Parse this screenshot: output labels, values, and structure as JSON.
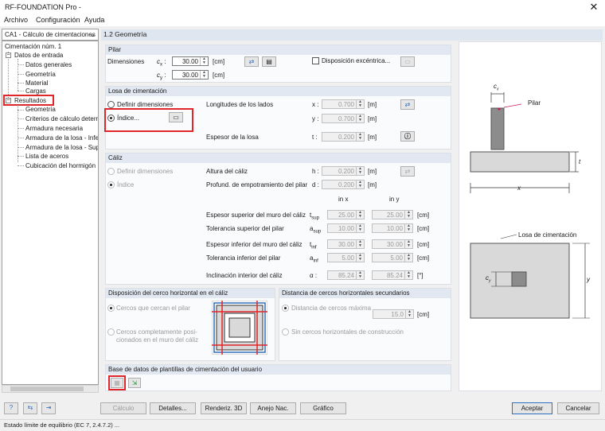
{
  "window": {
    "title": "RF-FOUNDATION Pro -",
    "close": "✕"
  },
  "menu": [
    "Archivo",
    "Configuración",
    "Ayuda"
  ],
  "case_selector": "CA1 - Cálculo de cimentaciones",
  "tree": {
    "root": "Cimentación núm. 1",
    "input": "Datos de entrada",
    "input_items": [
      "Datos generales",
      "Geometría",
      "Material",
      "Cargas"
    ],
    "results": "Resultados",
    "result_items": [
      "Geometría",
      "Criterios de cálculo determ",
      "Armadura necesaria",
      "Armadura de la losa - Infer",
      "Armadura de la losa - Supe",
      "Lista de aceros",
      "Cubicación del hormigón"
    ]
  },
  "page_title": "1.2 Geometría",
  "pilar": {
    "header": "Pilar",
    "dims_label": "Dimensiones",
    "cx_sym": "c",
    "cx_sub": "x",
    "cx_value": "30.00",
    "cy_sym": "c",
    "cy_sub": "y",
    "cy_value": "30.00",
    "unit": "[cm]",
    "eccentric_label": "Disposición excéntrica..."
  },
  "losa": {
    "header": "Losa de cimentación",
    "opt_define": "Definir dimensiones",
    "opt_index": "Índice...",
    "sides_label": "Longitudes de los lados",
    "x_label": "x :",
    "x_value": "0.700",
    "y_label": "y :",
    "y_value": "0.700",
    "unit_m": "[m]",
    "thick_label": "Espesor de la losa",
    "t_label": "t :",
    "t_value": "0.200"
  },
  "caliz": {
    "header": "Cáliz",
    "opt_define": "Definir dimensiones",
    "opt_index": "Índice",
    "rows": [
      {
        "label": "Altura del cáliz",
        "sym": "h :",
        "value": "0.200",
        "unit": "[m]"
      },
      {
        "label": "Profund. de empotramiento del pilar",
        "sym": "d :",
        "value": "0.200",
        "unit": "[m]"
      }
    ],
    "in_x": "in x",
    "in_y": "in y",
    "rows2": [
      {
        "label": "Espesor superior del muro del cáliz",
        "sym": "t",
        "sub": "sup",
        "vx": "25.00",
        "vy": "25.00",
        "unit": "[cm]"
      },
      {
        "label": "Tolerancia superior del pilar",
        "sym": "a",
        "sub": "sup",
        "vx": "10.00",
        "vy": "10.00",
        "unit": "[cm]"
      },
      {
        "label": "Espesor inferior del muro del cáliz",
        "sym": "t",
        "sub": "inf",
        "vx": "30.00",
        "vy": "30.00",
        "unit": "[cm]"
      },
      {
        "label": "Tolerancia inferior del pilar",
        "sym": "a",
        "sub": "inf",
        "vx": "5.00",
        "vy": "5.00",
        "unit": "[cm]"
      },
      {
        "label": "Inclinación interior del cáliz",
        "sym": "α :",
        "sub": "",
        "vx": "85.24",
        "vy": "85.24",
        "unit": "[°]"
      }
    ]
  },
  "hoops": {
    "header": "Disposición del cerco horizontal en el cáliz",
    "opt1": "Cercos que cercan el pilar",
    "opt2a": "Cercos completamente posi-",
    "opt2b": "cionados en el muro del cáliz"
  },
  "spacing": {
    "header": "Distancia de cercos horizontales secundarios",
    "opt1": "Distancia de cercos máxima",
    "value": "15.0",
    "unit": "[cm]",
    "opt2": "Sin cercos horizontales de construcción"
  },
  "templates": {
    "header": "Base de datos de plantillas de cimentación del usuario"
  },
  "diagram": {
    "cx": "c",
    "cx_sub": "x",
    "pilar": "Pilar",
    "t": "t",
    "x": "x",
    "losa": "Losa de cimentación",
    "cy": "c",
    "cy_sub": "y",
    "y": "y"
  },
  "buttons": {
    "calc": "Cálculo",
    "details": "Detalles...",
    "render": "Renderiz. 3D",
    "annex": "Anejo Nac.",
    "graphic": "Gráfico",
    "accept": "Aceptar",
    "cancel": "Cancelar"
  },
  "status": "Estado límite de equilibrio (EC 7, 2.4.7.2) ...",
  "colors": {
    "highlight": "#e0252b",
    "header_bg": "#e2e8f1",
    "accent": "#2f6fbf"
  }
}
